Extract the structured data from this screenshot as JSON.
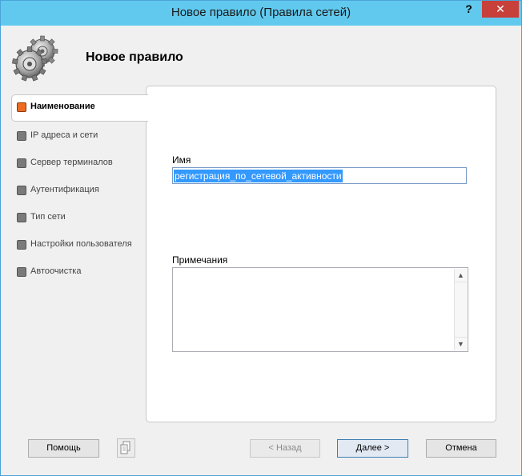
{
  "window": {
    "title": "Новое правило (Правила сетей)",
    "help_glyph": "?",
    "close_glyph": "✕"
  },
  "header": {
    "title": "Новое правило",
    "icon": "gears-icon"
  },
  "steps": [
    {
      "label": "Наименование",
      "active": true
    },
    {
      "label": "IP адреса и сети",
      "active": false
    },
    {
      "label": "Сервер терминалов",
      "active": false
    },
    {
      "label": "Аутентификация",
      "active": false
    },
    {
      "label": "Тип сети",
      "active": false
    },
    {
      "label": "Настройки пользователя",
      "active": false
    },
    {
      "label": "Автоочистка",
      "active": false
    }
  ],
  "form": {
    "name_label": "Имя",
    "name_value": "регистрация_по_сетевой_активности",
    "notes_label": "Примечания",
    "notes_value": ""
  },
  "buttons": {
    "help": "Помощь",
    "back": "< Назад",
    "next": "Далее >",
    "cancel": "Отмена"
  },
  "colors": {
    "titlebar": "#61c9ee",
    "close": "#c7403a",
    "active_step": "#ee6a1e",
    "inactive_step": "#7a7a7a",
    "selection": "#3399ff"
  }
}
